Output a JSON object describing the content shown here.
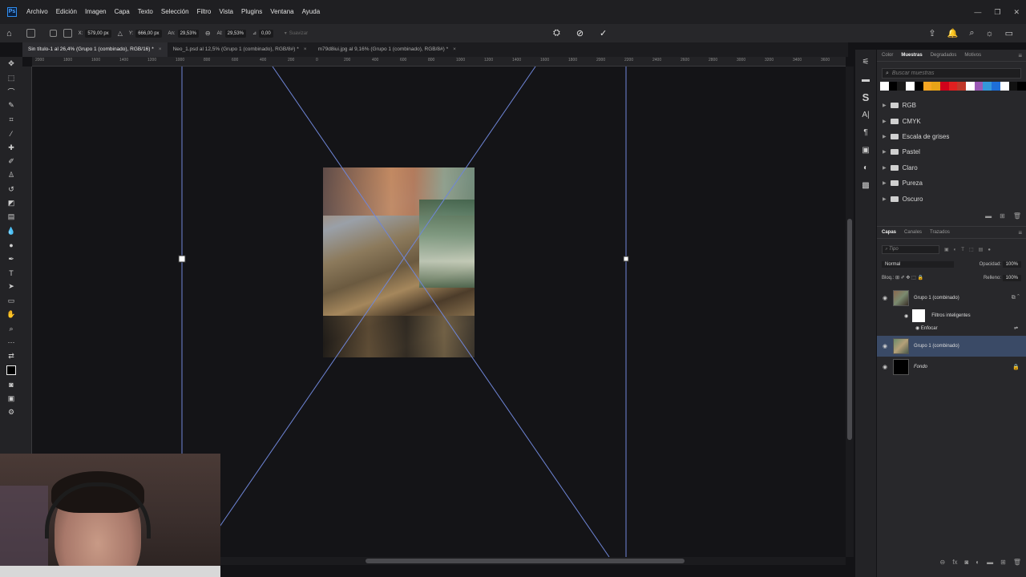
{
  "menu": [
    "Archivo",
    "Edición",
    "Imagen",
    "Capa",
    "Texto",
    "Selección",
    "Filtro",
    "Vista",
    "Plugins",
    "Ventana",
    "Ayuda"
  ],
  "app_logo": "Ps",
  "options": {
    "x_label": "X:",
    "x_value": "579,00 px",
    "y_label": "Y:",
    "y_value": "666,00 px",
    "w_label": "An:",
    "w_value": "29,53%",
    "h_label": "Al:",
    "h_value": "29,53%",
    "angle_label": "⊿",
    "angle_value": "0,00",
    "interp_label": "Suavizar"
  },
  "tabs": [
    {
      "label": "Sin título-1 al 26,4% (Grupo 1 (combinado), RGB/16) *",
      "active": true
    },
    {
      "label": "Neo_1.psd al 12,5% (Grupo 1 (combinado), RGB/8#) *",
      "active": false
    },
    {
      "label": "m79d8iui.jpg al 9,16% (Grupo 1 (combinado), RGB/8#) *",
      "active": false
    }
  ],
  "ruler_labels": [
    "2000",
    "1800",
    "1600",
    "1400",
    "1200",
    "1000",
    "800",
    "600",
    "400",
    "200",
    "0",
    "200",
    "400",
    "600",
    "800",
    "1000",
    "1200",
    "1400",
    "1600",
    "1800",
    "2000",
    "2200",
    "2400",
    "2600",
    "2800",
    "3000",
    "3200",
    "3400",
    "3600"
  ],
  "swatches_panel": {
    "tabs": [
      "Color",
      "Muestras",
      "Degradados",
      "Motivos"
    ],
    "active_tab": "Muestras",
    "search_placeholder": "Buscar muestras",
    "colors": [
      "#ffffff",
      "#000000",
      "#1a1a1a",
      "#ffffff",
      "#000000",
      "#f5a623",
      "#e8a317",
      "#d0021b",
      "#e02020",
      "#c0392b",
      "#ffffff",
      "#9b59b6",
      "#3498db",
      "#1e6fd9",
      "#ffffff",
      "#111111",
      "#000000"
    ],
    "folders": [
      "RGB",
      "CMYK",
      "Escala de grises",
      "Pastel",
      "Claro",
      "Pureza",
      "Oscuro"
    ]
  },
  "layers_panel": {
    "tabs": [
      "Capas",
      "Canales",
      "Trazados"
    ],
    "active_tab": "Capas",
    "filter_placeholder": "Tipo",
    "blend_mode": "Normal",
    "opacity_label": "Opacidad:",
    "opacity_value": "100%",
    "lock_label": "Bloq.:",
    "fill_label": "Relleno:",
    "fill_value": "100%",
    "layers": [
      {
        "name": "Grupo 1 (combinado)",
        "selected": false
      },
      {
        "name": "Grupo 1 (combinado)",
        "selected": true
      },
      {
        "name": "Fondo",
        "selected": false
      }
    ],
    "smart_filters_label": "Filtros inteligentes",
    "smart_filter_item": "Enfocar"
  },
  "icons": {
    "home": "home-icon",
    "commit": "checkmark-icon",
    "cancel": "cancel-icon",
    "warp": "warp-icon"
  }
}
